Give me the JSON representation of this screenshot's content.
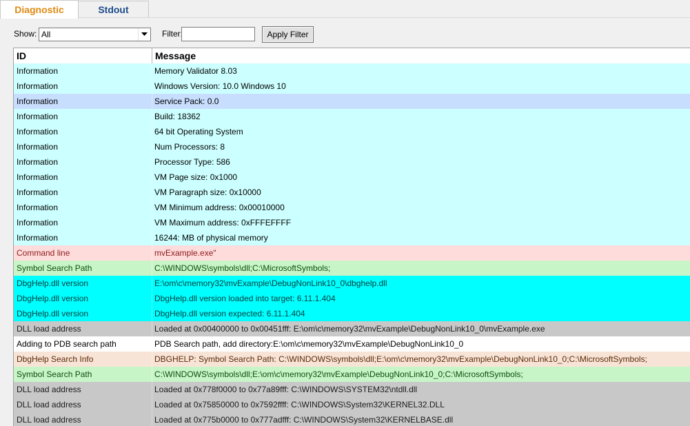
{
  "tabs": [
    {
      "label": "Diagnostic",
      "active": true
    },
    {
      "label": "Stdout",
      "active": false
    }
  ],
  "toolbar": {
    "show_label": "Show:",
    "show_value": "All",
    "filter_label": "Filter:",
    "filter_value": "",
    "apply_label": "Apply Filter"
  },
  "grid": {
    "col_id": "ID",
    "col_message": "Message",
    "rows": [
      {
        "id": "Information",
        "message": "Memory Validator 8.03",
        "bg": "#ccffff",
        "color": "#000000"
      },
      {
        "id": "Information",
        "message": "Windows Version: 10.0 Windows 10",
        "bg": "#ccffff",
        "color": "#000000"
      },
      {
        "id": "Information",
        "message": "Service Pack: 0.0",
        "bg": "#c8deff",
        "color": "#000000"
      },
      {
        "id": "Information",
        "message": "Build: 18362",
        "bg": "#ccffff",
        "color": "#000000"
      },
      {
        "id": "Information",
        "message": "64 bit Operating System",
        "bg": "#ccffff",
        "color": "#000000"
      },
      {
        "id": "Information",
        "message": "Num Processors: 8",
        "bg": "#ccffff",
        "color": "#000000"
      },
      {
        "id": "Information",
        "message": "Processor Type: 586",
        "bg": "#ccffff",
        "color": "#000000"
      },
      {
        "id": "Information",
        "message": "VM Page size: 0x1000",
        "bg": "#ccffff",
        "color": "#000000"
      },
      {
        "id": "Information",
        "message": "VM Paragraph size: 0x10000",
        "bg": "#ccffff",
        "color": "#000000"
      },
      {
        "id": "Information",
        "message": "VM Minimum address: 0x00010000",
        "bg": "#ccffff",
        "color": "#000000"
      },
      {
        "id": "Information",
        "message": "VM Maximum address: 0xFFFEFFFF",
        "bg": "#ccffff",
        "color": "#000000"
      },
      {
        "id": "Information",
        "message": "16244: MB of physical memory",
        "bg": "#ccffff",
        "color": "#000000"
      },
      {
        "id": "Command line",
        "message": "mvExample.exe\"",
        "bg": "#ffdcdc",
        "color": "#8b1a1a"
      },
      {
        "id": "Symbol Search Path",
        "message": "C:\\WINDOWS\\symbols\\dll;C:\\MicrosoftSymbols;",
        "bg": "#c8f5c8",
        "color": "#0d4d0d"
      },
      {
        "id": "DbgHelp.dll version",
        "message": "E:\\om\\c\\memory32\\mvExample\\DebugNonLink10_0\\dbghelp.dll",
        "bg": "#00ffff",
        "color": "#004040"
      },
      {
        "id": "DbgHelp.dll version",
        "message": "DbgHelp.dll version loaded into target: 6.11.1.404",
        "bg": "#00ffff",
        "color": "#004040"
      },
      {
        "id": "DbgHelp.dll version",
        "message": "DbgHelp.dll version expected: 6.11.1.404",
        "bg": "#00ffff",
        "color": "#004040"
      },
      {
        "id": "DLL load address",
        "message": "Loaded at 0x00400000 to 0x00451fff: E:\\om\\c\\memory32\\mvExample\\DebugNonLink10_0\\mvExample.exe",
        "bg": "#c8c8c8",
        "color": "#1a1a1a"
      },
      {
        "id": "Adding to PDB search path",
        "message": "PDB Search path, add directory:E:\\om\\c\\memory32\\mvExample\\DebugNonLink10_0",
        "bg": "#ffffff",
        "color": "#000000"
      },
      {
        "id": "DbgHelp Search Info",
        "message": "DBGHELP: Symbol Search Path: C:\\WINDOWS\\symbols\\dll;E:\\om\\c\\memory32\\mvExample\\DebugNonLink10_0;C:\\MicrosoftSymbols;",
        "bg": "#f8e4d6",
        "color": "#5a2a0a"
      },
      {
        "id": "Symbol Search Path",
        "message": "C:\\WINDOWS\\symbols\\dll;E:\\om\\c\\memory32\\mvExample\\DebugNonLink10_0;C:\\MicrosoftSymbols;",
        "bg": "#c8f5c8",
        "color": "#0d4d0d"
      },
      {
        "id": "DLL load address",
        "message": "Loaded at 0x778f0000 to 0x77a89fff: C:\\WINDOWS\\SYSTEM32\\ntdll.dll",
        "bg": "#c8c8c8",
        "color": "#1a1a1a"
      },
      {
        "id": "DLL load address",
        "message": "Loaded at 0x75850000 to 0x7592ffff: C:\\WINDOWS\\System32\\KERNEL32.DLL",
        "bg": "#c8c8c8",
        "color": "#1a1a1a"
      },
      {
        "id": "DLL load address",
        "message": "Loaded at 0x775b0000 to 0x777adfff: C:\\WINDOWS\\System32\\KERNELBASE.dll",
        "bg": "#c8c8c8",
        "color": "#1a1a1a"
      }
    ]
  }
}
